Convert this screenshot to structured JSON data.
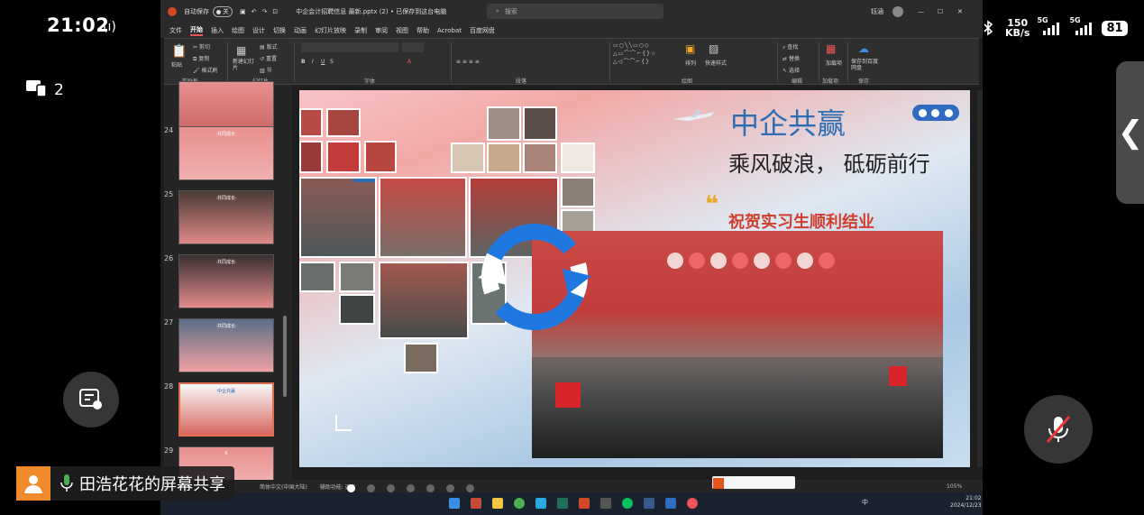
{
  "phone": {
    "time": "21:02",
    "net_speed_value": "150",
    "net_speed_unit": "KB/s",
    "sig1": "5G",
    "sig2": "5G",
    "battery": "81",
    "screens_count": "2"
  },
  "share": {
    "text": "田浩花花的屏幕共享"
  },
  "ppt": {
    "autosave_label": "自动保存",
    "autosave_state": "关",
    "file_title": "中企会计招聘信息 最新.pptx (2) • 已保存到这台电脑",
    "search_placeholder": "搜索",
    "user": "钰涵",
    "tabs": [
      "文件",
      "开始",
      "插入",
      "绘图",
      "设计",
      "切换",
      "动画",
      "幻灯片放映",
      "录制",
      "审阅",
      "视图",
      "帮助",
      "Acrobat",
      "百度网盘"
    ],
    "active_tab_index": 1,
    "ribbon_groups": [
      "剪贴板",
      "幻灯片",
      "字体",
      "段落",
      "绘图",
      "编辑",
      "加载项",
      "保存"
    ],
    "ribbon_buttons": {
      "paste": "粘贴",
      "cut": "剪切",
      "copy": "复制",
      "format_painter": "格式刷",
      "new_slide": "新建幻灯片",
      "layout": "版式",
      "reset": "重置",
      "section": "节",
      "arrange": "排列",
      "quick_styles": "快速样式",
      "find": "查找",
      "replace": "替换",
      "select": "选择",
      "addins": "加载项",
      "save_baidu": "保存到百度网盘"
    },
    "thumbnails": [
      {
        "num": "24",
        "label": "·共同成长·"
      },
      {
        "num": "25",
        "label": "·共同成长·"
      },
      {
        "num": "26",
        "label": "·共同成长·"
      },
      {
        "num": "27",
        "label": "·共同成长·"
      },
      {
        "num": "28",
        "label": "中企共赢",
        "selected": true
      },
      {
        "num": "29",
        "label": "6"
      }
    ],
    "slide": {
      "title": "中企共赢",
      "subtitle": "乘风破浪， 砥砺前行",
      "caption": "祝贺实习生顺利结业"
    },
    "status": {
      "language": "简体中文(中国大陆)",
      "accessibility": "辅助功能: 调查",
      "zoom": "105%"
    },
    "sys_time": "21:02",
    "sys_date": "2024/12/23",
    "ime_lang": "中"
  },
  "colors": {
    "title_blue": "#2c6db4",
    "caption_red": "#d23c2b",
    "accent_orange": "#f08a2a"
  }
}
